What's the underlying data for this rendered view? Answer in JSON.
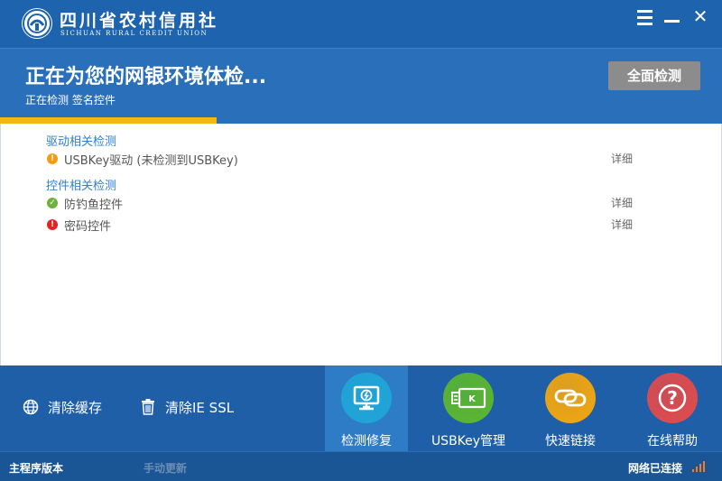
{
  "titlebar": {
    "logo_cn": "四川省农村信用社",
    "logo_en": "SICHUAN RURAL CREDIT UNION",
    "menu_icon": "hamburger-menu-icon",
    "minimize_icon": "minimize-icon",
    "close_glyph": "✕"
  },
  "header": {
    "title": "正在为您的网银环境体检...",
    "subtitle": "正在检测 签名控件",
    "full_scan_label": "全面检测",
    "progress_fraction": 0.3,
    "progress_color": "#f6b515"
  },
  "sections": [
    {
      "title": "驱动相关检测",
      "items": [
        {
          "label": "USBKey驱动 (未检测到USBKey)",
          "status": "warning",
          "status_icon": "warning-icon",
          "glyph": "!",
          "color": "#f39c12",
          "detail": "详细"
        }
      ]
    },
    {
      "title": "控件相关检测",
      "items": [
        {
          "label": "防钓鱼控件",
          "status": "ok",
          "status_icon": "check-icon",
          "glyph": "✓",
          "color": "#6cb33e",
          "detail": "详细"
        },
        {
          "label": "密码控件",
          "status": "error",
          "status_icon": "error-icon",
          "glyph": "!",
          "color": "#e52222",
          "detail": "详细"
        }
      ]
    }
  ],
  "tools": {
    "clear_cache": {
      "label": "清除缓存",
      "icon": "globe-icon"
    },
    "clear_ssl": {
      "label": "清除IE SSL",
      "icon": "trash-icon"
    }
  },
  "features": [
    {
      "label": "检测修复",
      "icon": "monitor-repair-icon",
      "color": "#1fa6d8",
      "active": true
    },
    {
      "label": "USBKey管理",
      "icon": "usbkey-icon",
      "color": "#5cb82d",
      "active": false
    },
    {
      "label": "快速链接",
      "icon": "link-icon",
      "color": "#f5a70d",
      "active": false
    },
    {
      "label": "在线帮助",
      "icon": "help-icon",
      "color": "#e34b4b",
      "active": false
    }
  ],
  "status": {
    "version_label": "主程序版本",
    "update_label": "手动更新",
    "network_label": "网络已连接",
    "network_icon": "signal-icon"
  }
}
